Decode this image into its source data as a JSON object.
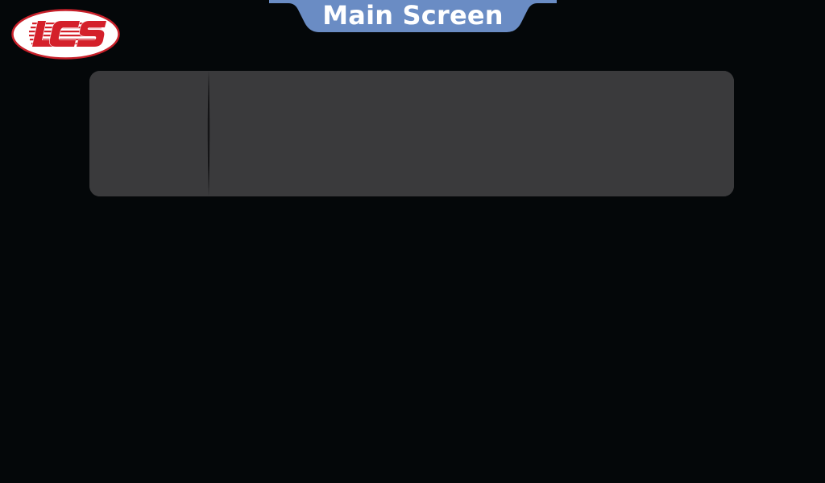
{
  "logo": {
    "text": "LCS",
    "color": "#d4202a"
  },
  "header": {
    "title": "Main Screen",
    "tab_color": "#6a8cc4"
  },
  "panel": {
    "background": "#3a3a3c",
    "left_section": "",
    "right_section": ""
  }
}
